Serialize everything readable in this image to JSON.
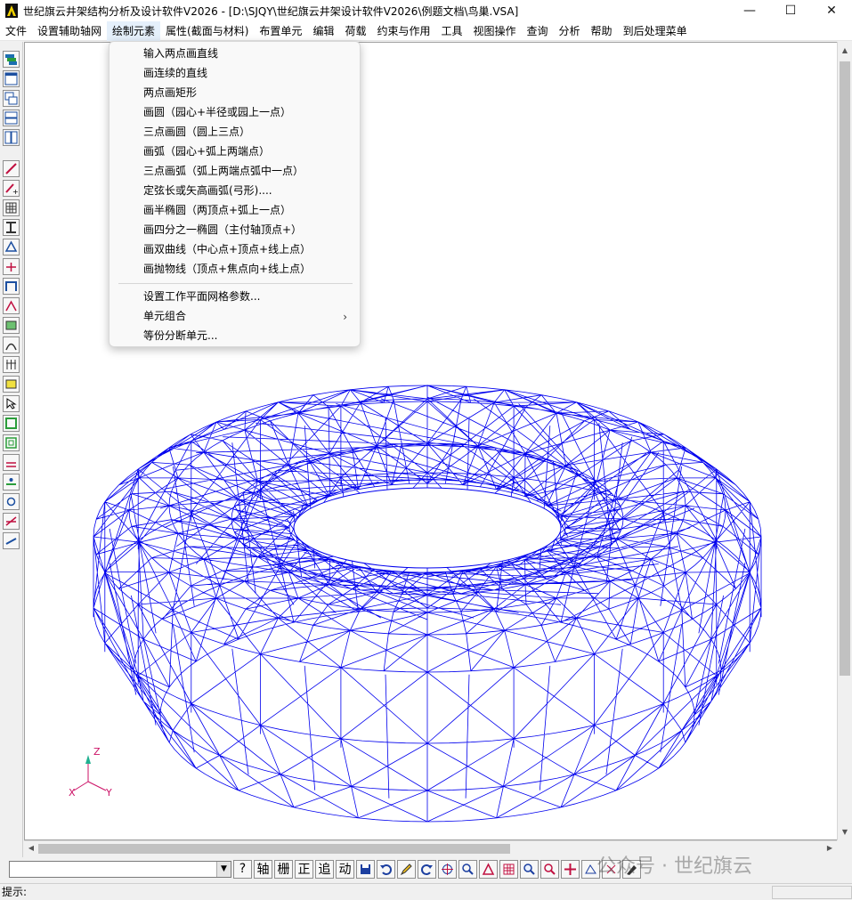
{
  "window": {
    "title": "世纪旗云井架结构分析及设计软件V2026  - [D:\\SJQY\\世纪旗云井架设计软件V2026\\例题文档\\鸟巢.VSA]",
    "minimize_glyph": "—",
    "maximize_glyph": "☐",
    "close_glyph": "✕"
  },
  "menubar": {
    "items": [
      "文件",
      "设置辅助轴网",
      "绘制元素",
      "属性(截面与材料)",
      "布置单元",
      "编辑",
      "荷载",
      "约束与作用",
      "工具",
      "视图操作",
      "查询",
      "分析",
      "帮助",
      "到后处理菜单"
    ],
    "active_index": 2
  },
  "dropdown": {
    "items": [
      "输入两点画直线",
      "画连续的直线",
      "两点画矩形",
      "画圆（园心+半径或园上一点）",
      "三点画圆（圆上三点）",
      "画弧（园心+弧上两端点）",
      "三点画弧（弧上两端点弧中一点）",
      "定弦长或矢高画弧(弓形)....",
      "画半椭圆（两顶点+弧上一点）",
      "画四分之一椭圆（主付轴顶点+）",
      "画双曲线（中心点+顶点+线上点）",
      "画抛物线（顶点+焦点向+线上点）"
    ],
    "items2": [
      "设置工作平面网格参数...",
      "单元组合",
      "等份分断单元..."
    ],
    "submenu_arrow": "›"
  },
  "triad": {
    "z": "Z",
    "x": "X",
    "y": "Y"
  },
  "bottom_toolbar": {
    "command_value": "",
    "dropdown_glyph": "▼",
    "text_buttons": [
      "?",
      "轴",
      "栅",
      "正",
      "追",
      "动"
    ]
  },
  "statusbar": {
    "prompt": "提示:"
  },
  "watermark": "公众号 · 世纪旗云",
  "colors": {
    "model_lines": "#0000ee",
    "triad": "#cc1166",
    "selected_menu": "#e5f0fb"
  }
}
